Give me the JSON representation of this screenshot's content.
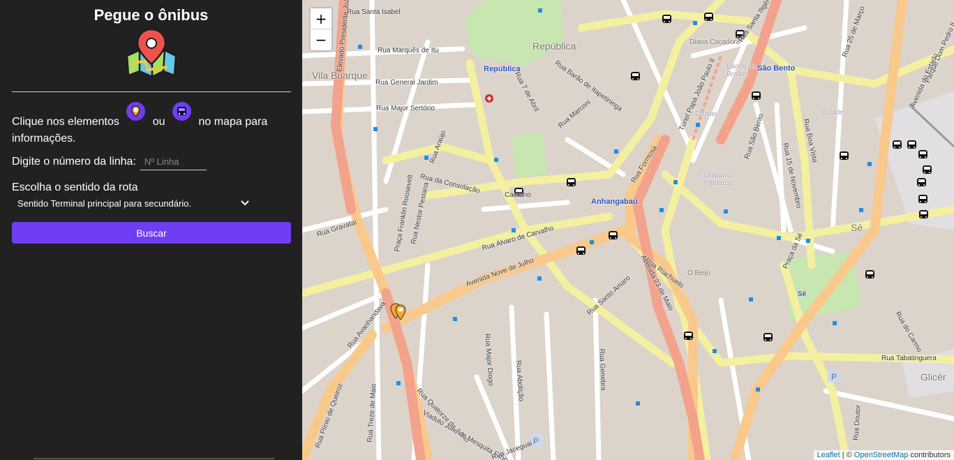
{
  "sidebar": {
    "title": "Pegue o ônibus",
    "info_prefix": "Clique nos elementos",
    "info_or": "ou",
    "info_suffix": "no mapa para informações.",
    "line_label": "Digite o número da linha:",
    "line_placeholder": "Nº Linha",
    "route_label": "Escolha o sentido da rota",
    "route_selected": "Sentido Terminal principal para secundário.",
    "search_button": "Buscar",
    "accent_color": "#6f3df2"
  },
  "map": {
    "zoom_in": "+",
    "zoom_out": "−",
    "labels": {
      "republica_area": "República",
      "vila_buarque": "Vila Buarque",
      "republica_station": "República",
      "anhangabau": "Anhangabaú",
      "sao_bento": "São Bento",
      "banco_boston": "Banco de Boston",
      "diana": "Diana Cacadora",
      "drusas": "Drusas",
      "umbanco": "Unibanco Patriarca",
      "se": "Sé",
      "se2": "Sé",
      "o_beijo": "O Beijo",
      "cidade": "Cidade",
      "glicerio": "Glicér",
      "r_santa_isabel": "Rua Santa Isabel",
      "r_marques_itu": "Rua Marquês de Itu",
      "r_general_jardim": "Rua General Jardim",
      "r_major_sertorio": "Rua Major Sertório",
      "r_consolacao": "Rua da Consolação",
      "r_gravatai": "Rua Gravataí",
      "r_alvaro": "Rua Álvaro de Carvalho",
      "av_nove_julho": "Avenida Nove de Julho",
      "r_riachuelo": "Rua Riachuelo",
      "av_23_maio": "Avenida 23 de Maio",
      "r_santo_amaro": "Rua Santo Amaro",
      "r_tabatinguera": "Rua Tabatinguera",
      "r_boa_vista": "Rua Boa Vista",
      "r_15_novembro": "Rua 15 de Novembro",
      "r_sao_bento": "Rua São Bento",
      "r_7_abril": "Rua 7 de Abril",
      "r_barao": "Rua Barão de Itapetininga",
      "r_marconi": "Rua Marconi",
      "r_formosa": "Rua Formosa",
      "tunel": "Túnel Papa João Paulo II",
      "praca_se": "Praça da Sé",
      "r_genebra": "Rua Genebra",
      "r_jaguaribe": "Rua Jaguaribe",
      "r_frei_caneca": "Rua Quatorze de Julho",
      "viaduto": "Viaduto Júlio de Mesquita Filho",
      "r_avanhandava": "Rua Avanhandava",
      "r_nestor": "Rua Nestor Pestana",
      "praca_franklin": "Praça Franklin Roosevelt",
      "elevado": "Elevado Presidente João",
      "r_araujo": "Rua Araújo",
      "r_major_diogo": "Rua Major Diogo",
      "r_abolicao": "Rua Abolição",
      "r_jaceguai": "Rua Jaceguai",
      "r_treze_maio": "Rua Treze de Maio",
      "r_plinio": "Rua Plínio de Queiroz",
      "r_santa_ifigenia": "Rua Santa Ifigênia",
      "cauciones": "Caetano",
      "pq_dom_pedro": "Parque Dom Pedro II",
      "r_25_marco": "Rua 25 de Março",
      "av_estado": "Avenida do Estado",
      "r_carmo": "Rua do Carmo",
      "r_doutro": "Rua Doutor"
    },
    "attribution": {
      "leaflet": "Leaflet",
      "separator": "|",
      "copyright": "©",
      "osm": "OpenStreetMap",
      "contributors": "contributors"
    }
  }
}
